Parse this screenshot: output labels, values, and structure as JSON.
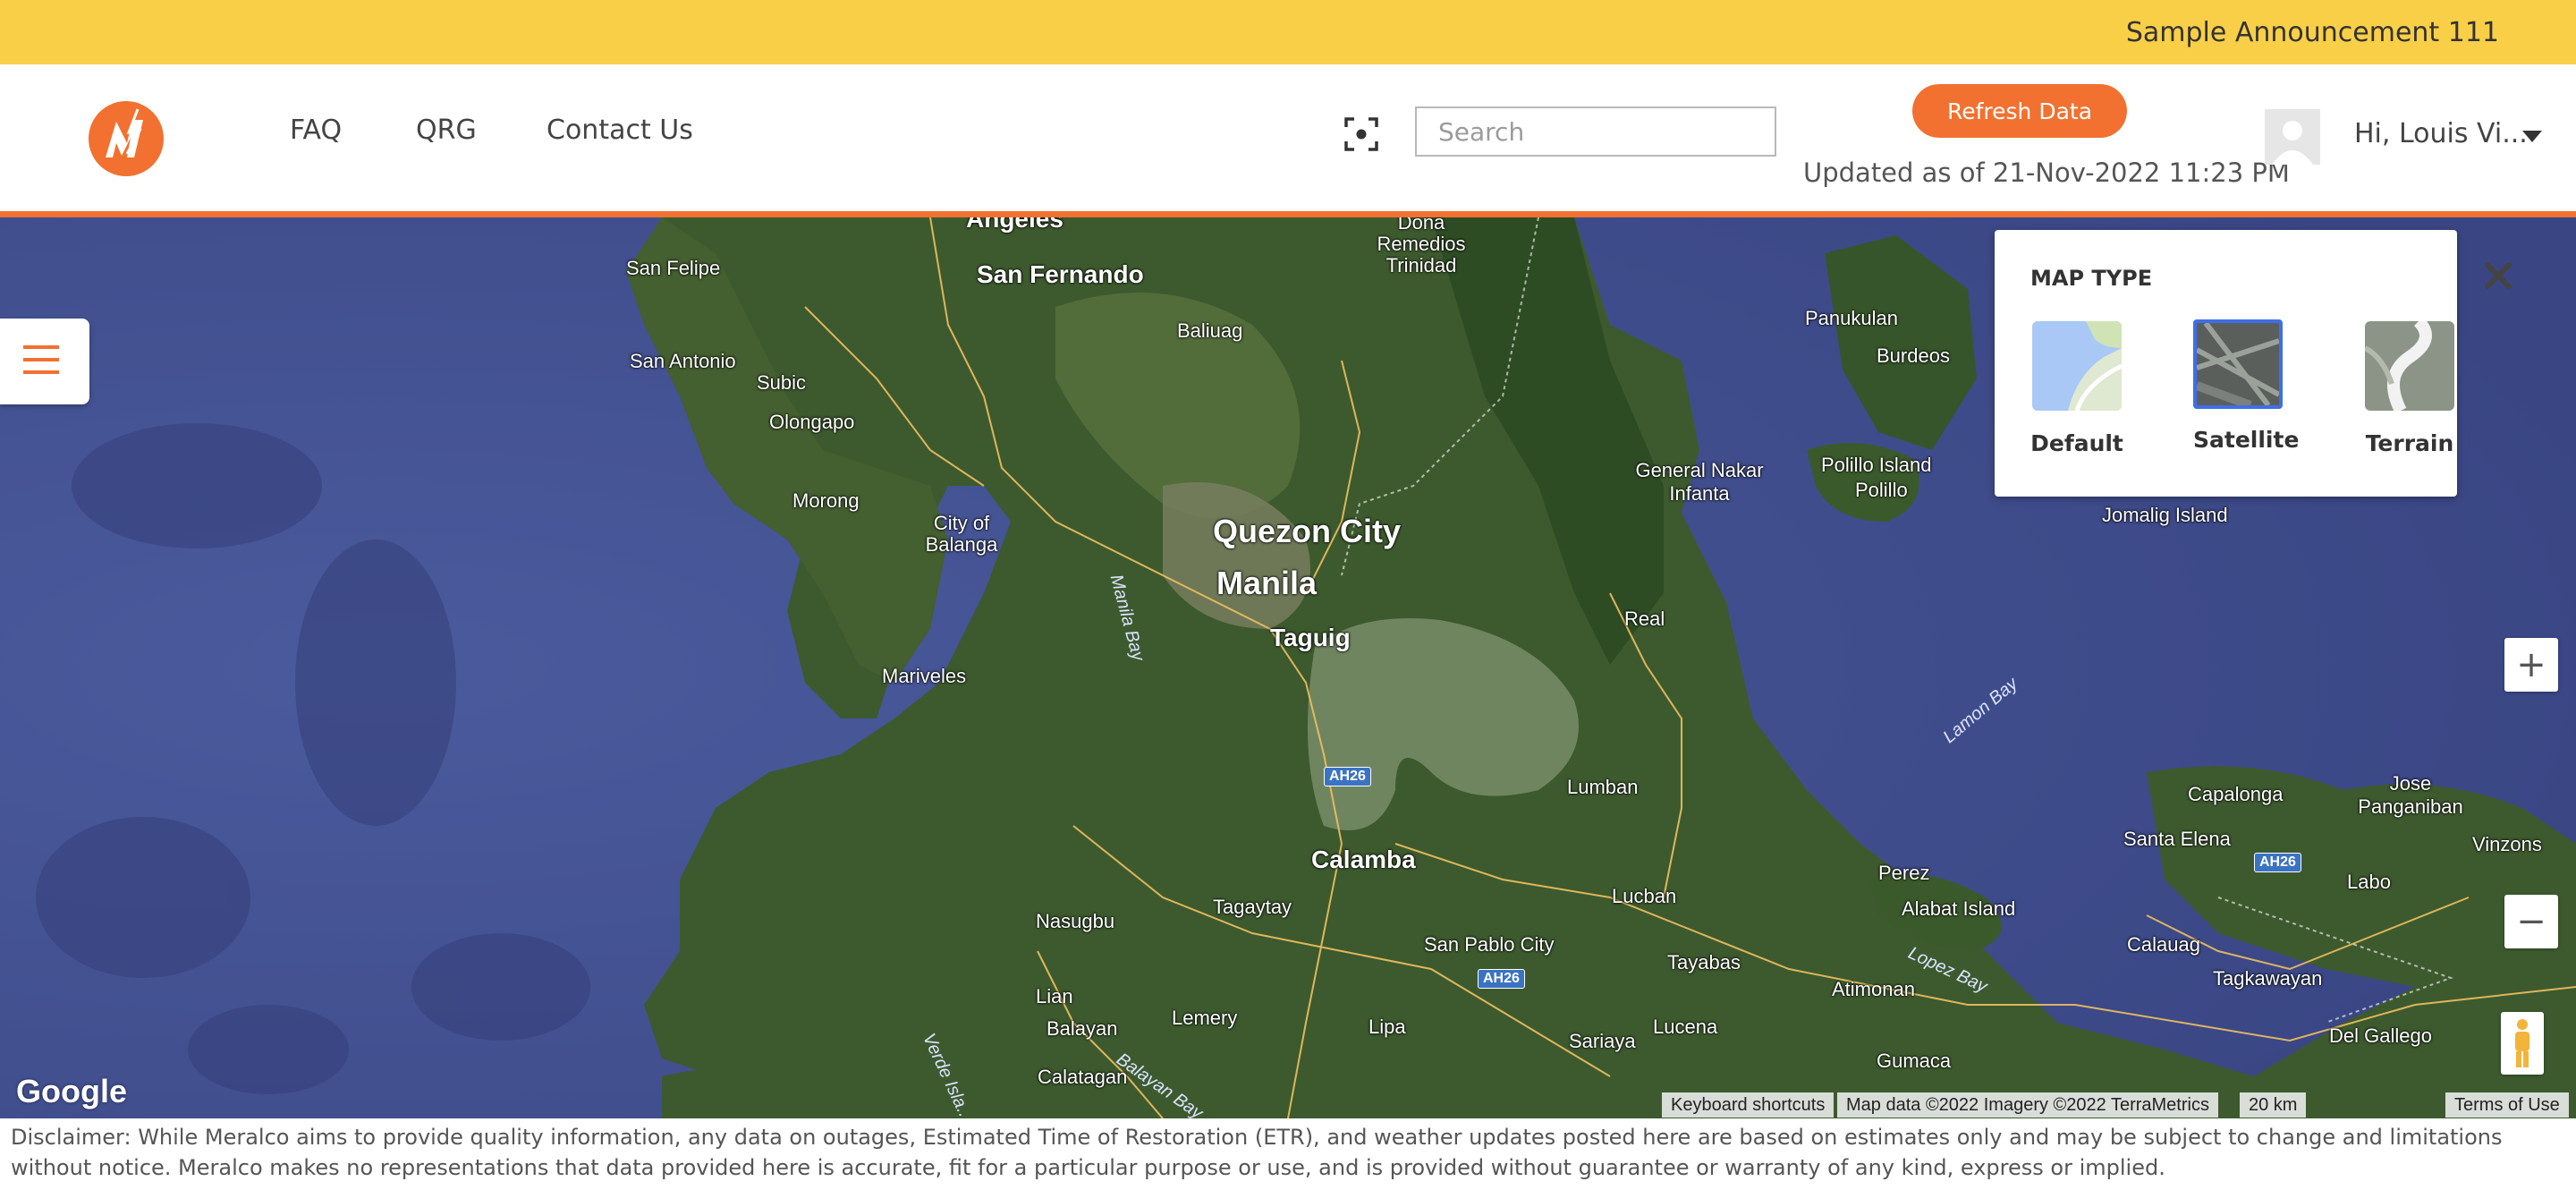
{
  "announcement": {
    "text": "Sample Announcement 111"
  },
  "header": {
    "nav": [
      {
        "label": "FAQ"
      },
      {
        "label": "QRG"
      },
      {
        "label": "Contact Us"
      }
    ],
    "search": {
      "placeholder": "Search",
      "value": ""
    },
    "refresh_label": "Refresh Data",
    "updated_text": "Updated as of 21-Nov-2022 11:23 PM",
    "user_greeting": "Hi, Louis Vi...",
    "accent_color": "#f27130"
  },
  "map": {
    "labels": {
      "angeles": "Angeles",
      "san_fernando": "San Fernando",
      "dona_remedios": "Dona Remedios Trinidad",
      "san_felipe": "San Felipe",
      "san_antonio": "San Antonio",
      "subic": "Subic",
      "olongapo": "Olongapo",
      "baliuag": "Baliuag",
      "morong": "Morong",
      "city_of_balanga": "City of Balanga",
      "quezon_city": "Quezon City",
      "manila": "Manila",
      "taguig": "Taguig",
      "mariveles": "Mariveles",
      "manila_bay": "Manila Bay",
      "general_nakar": "General Nakar Infanta",
      "panukulan": "Panukulan",
      "burdeos": "Burdeos",
      "polillo_island": "Polillo Island",
      "polillo": "Polillo",
      "jomalig": "Jomalig Island",
      "real": "Real",
      "lamon_bay": "Lamon Bay",
      "lumban": "Lumban",
      "calamba": "Calamba",
      "tagaytay": "Tagaytay",
      "nasugbu": "Nasugbu",
      "san_pablo": "San Pablo City",
      "lucban": "Lucban",
      "tayabas": "Tayabas",
      "perez": "Perez",
      "alabat": "Alabat Island",
      "lopez_bay": "Lopez Bay",
      "atimonan": "Atimonan",
      "capalonga": "Capalonga",
      "jose_panganiban": "Jose Panganiban",
      "santa_elena": "Santa Elena",
      "labo": "Labo",
      "vinzons": "Vinzons",
      "calauag": "Calauag",
      "tagkawayan": "Tagkawayan",
      "del_gallego": "Del Gallego",
      "lian": "Lian",
      "balayan": "Balayan",
      "lemery": "Lemery",
      "lipa": "Lipa",
      "sariaya": "Sariaya",
      "lucena": "Lucena",
      "gumaca": "Gumaca",
      "calatagan": "Calatagan",
      "verde_island": "Verde Isla...",
      "balayan_bay": "Balayan Bay",
      "route_1": "AH26",
      "route_2": "AH26",
      "route_3": "AH26"
    },
    "map_type_panel": {
      "title": "MAP TYPE",
      "options": [
        {
          "label": "Default",
          "selected": false
        },
        {
          "label": "Satellite",
          "selected": true
        },
        {
          "label": "Terrain",
          "selected": false
        }
      ],
      "selected_border_color": "#3f6ee8"
    },
    "zoom": {
      "in": "+",
      "out": "−"
    },
    "google_logo": "Google",
    "attribution": {
      "shortcuts": "Keyboard shortcuts",
      "map_data": "Map data ©2022 Imagery ©2022 TerraMetrics",
      "scale": "20 km",
      "terms": "Terms of Use"
    }
  },
  "disclaimer": "Disclaimer: While Meralco aims to provide quality information, any data on outages, Estimated Time of Restoration (ETR), and weather updates posted here are based on estimates only and may be subject to change and limitations without notice. Meralco makes no representations that data provided here is accurate, fit for a particular purpose or use, and is provided without guarantee or warranty of any kind, express or implied."
}
